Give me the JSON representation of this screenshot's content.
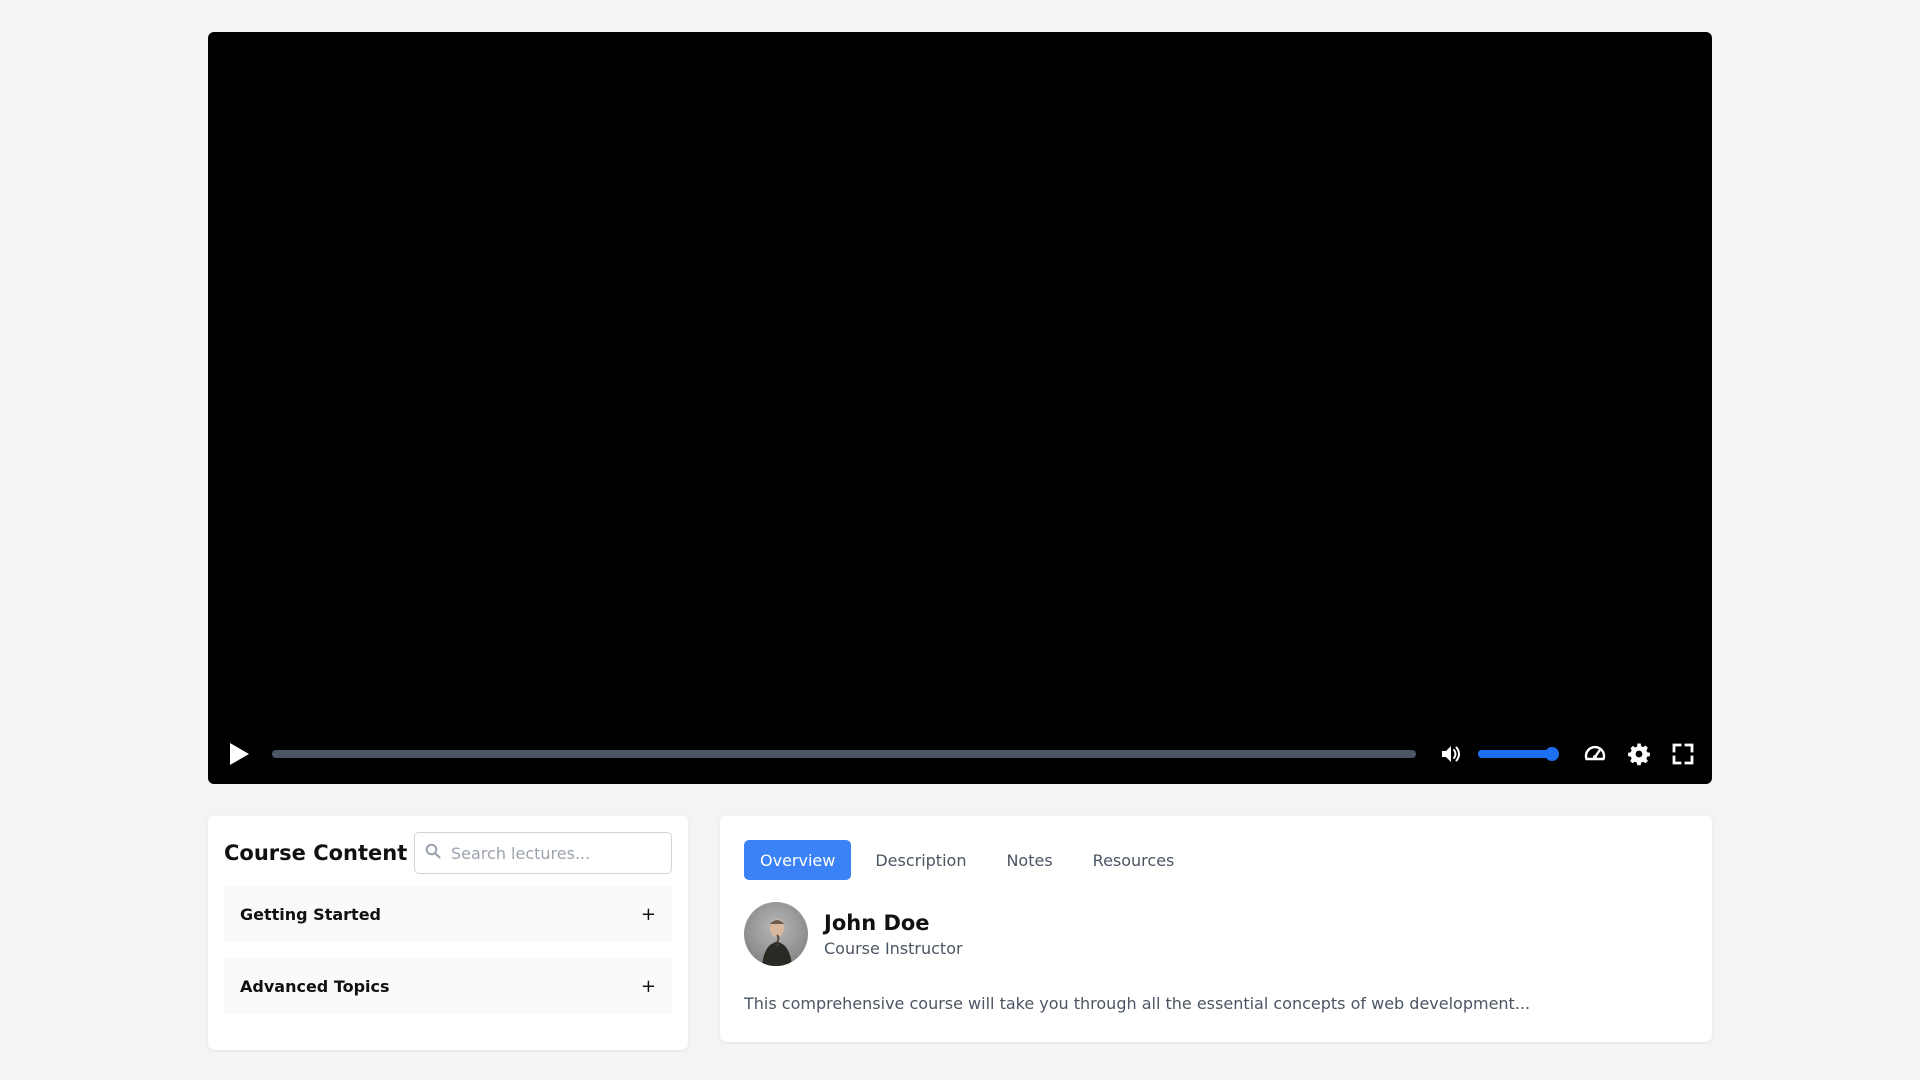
{
  "video": {
    "progress": 0,
    "volume": 0.95,
    "icons": {
      "play": "play-icon",
      "volume": "volume-icon",
      "speed": "speed-icon",
      "settings": "gear-icon",
      "fullscreen": "fullscreen-icon"
    },
    "accent_color": "#1d6ff2"
  },
  "course_content": {
    "title": "Course Content",
    "search_placeholder": "Search lectures...",
    "sections": [
      {
        "label": "Getting Started",
        "toggle": "+"
      },
      {
        "label": "Advanced Topics",
        "toggle": "+"
      }
    ]
  },
  "details": {
    "tabs": [
      {
        "label": "Overview",
        "active": true
      },
      {
        "label": "Description",
        "active": false
      },
      {
        "label": "Notes",
        "active": false
      },
      {
        "label": "Resources",
        "active": false
      }
    ],
    "instructor": {
      "name": "John Doe",
      "role": "Course Instructor"
    },
    "description": "This comprehensive course will take you through all the essential concepts of web development...",
    "active_tab_color": "#3b82f6"
  }
}
